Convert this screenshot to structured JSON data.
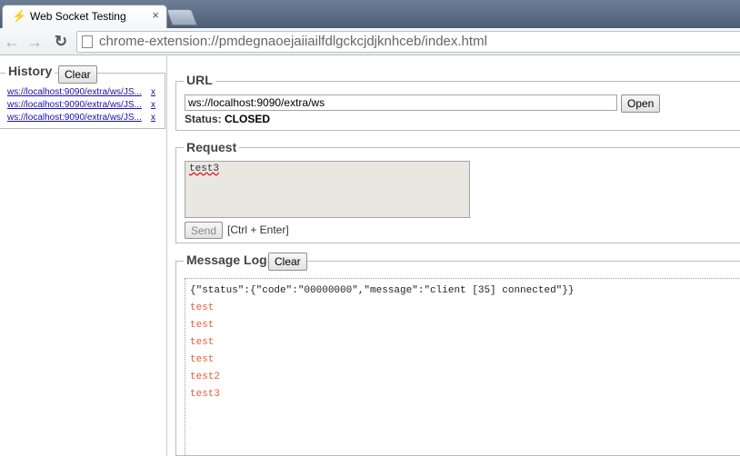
{
  "browser": {
    "tab_title": "Web Socket Testing",
    "tab_close": "×",
    "url": "chrome-extension://pmdegnaoejaiiailfdlgckcjdjknhceb/index.html"
  },
  "history": {
    "legend": "History",
    "clear_label": "Clear",
    "items": [
      {
        "label": "ws://localhost:9090/extra/ws/JS...",
        "remove": "x"
      },
      {
        "label": "ws://localhost:9090/extra/ws/JS...",
        "remove": "x"
      },
      {
        "label": "ws://localhost:9090/extra/ws/JS...",
        "remove": "x"
      }
    ]
  },
  "url_section": {
    "legend": "URL",
    "value": "ws://localhost:9090/extra/ws",
    "open_label": "Open",
    "status_label": "Status:",
    "status_value": "CLOSED"
  },
  "request": {
    "legend": "Request",
    "value": "test3",
    "send_label": "Send",
    "hint": "[Ctrl + Enter]"
  },
  "message_log": {
    "legend": "Message Log",
    "clear_label": "Clear",
    "lines": [
      {
        "text": "{\"status\":{\"code\":\"00000000\",\"message\":\"client [35] connected\"}}",
        "kind": "json"
      },
      {
        "text": "test",
        "kind": "msg"
      },
      {
        "text": "test",
        "kind": "msg"
      },
      {
        "text": "test",
        "kind": "msg"
      },
      {
        "text": "test",
        "kind": "msg"
      },
      {
        "text": "test2",
        "kind": "msg"
      },
      {
        "text": "test3",
        "kind": "msg"
      }
    ]
  },
  "colors": {
    "log_message": "#e0623a",
    "link": "#1a0dab"
  }
}
